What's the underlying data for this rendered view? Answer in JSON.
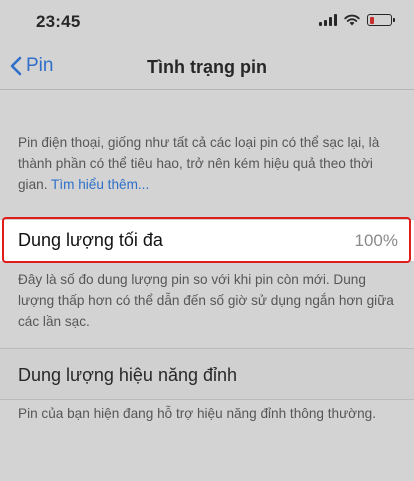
{
  "status_bar": {
    "time": "23:45",
    "icons": [
      "signal-icon",
      "wifi-icon",
      "battery-icon"
    ],
    "battery_color": "#e21b1b"
  },
  "nav": {
    "back_label": "Pin",
    "title": "Tình trạng pin"
  },
  "intro": {
    "text": "Pin điện thoại, giống như tất cả các loại pin có thể sạc lại, là thành phần có thể tiêu hao, trở nên kém hiệu quả theo thời gian.",
    "link": "Tìm hiểu thêm..."
  },
  "max_capacity": {
    "label": "Dung lượng tối đa",
    "value": "100%",
    "description": "Đây là số đo dung lượng pin so với khi pin còn mới. Dung lượng thấp hơn có thể dẫn đến số giờ sử dụng ngắn hơn giữa các lần sạc."
  },
  "peak_performance": {
    "label": "Dung lượng hiệu năng đỉnh",
    "description": "Pin của bạn hiện đang hỗ trợ hiệu năng đỉnh thông thường."
  },
  "colors": {
    "accent": "#1b6ee0",
    "highlight_border": "#e21b1b"
  }
}
